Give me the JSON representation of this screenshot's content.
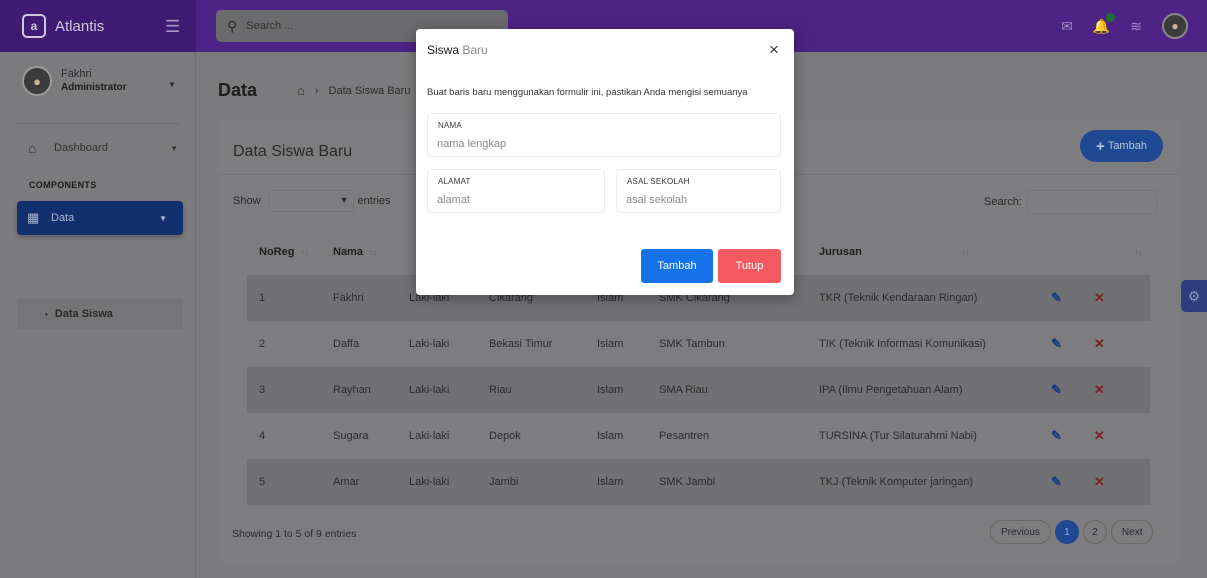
{
  "topbar": {
    "brand": "Atlantis",
    "logo_letter": "a",
    "search_placeholder": "Search ..."
  },
  "sidebar": {
    "user_name": "Fakhri",
    "user_role": "Administrator",
    "dashboard_label": "Dashboard",
    "section_title": "COMPONENTS",
    "data_label": "Data",
    "sub_item_label": "Data Siswa"
  },
  "page": {
    "title": "Data",
    "breadcrumb": "Data Siswa Baru"
  },
  "card": {
    "title": "Data Siswa Baru",
    "add_button": "Tambah",
    "show_label": "Show",
    "entries_label": "entries",
    "search_label": "Search:",
    "columns": [
      "NoReg",
      "Nama",
      "",
      "",
      "",
      "",
      "Jurusan",
      ""
    ],
    "rows": [
      [
        "1",
        "Fakhri",
        "Laki-laki",
        "Cikarang",
        "Islam",
        "SMK Cikarang",
        "TKR (Teknik Kendaraan Ringan)"
      ],
      [
        "2",
        "Daffa",
        "Laki-laki",
        "Bekasi Timur",
        "Islam",
        "SMK Tambun",
        "TIK (Teknik Informasi Komunikasi)"
      ],
      [
        "3",
        "Rayhan",
        "Laki-laki",
        "Riau",
        "Islam",
        "SMA Riau",
        "IPA (Ilmu Pengetahuan Alam)"
      ],
      [
        "4",
        "Sugara",
        "Laki-laki",
        "Depok",
        "Islam",
        "Pesantren",
        "TURSINA (Tur Silaturahmi Nabi)"
      ],
      [
        "5",
        "Amar",
        "Laki-laki",
        "Jambi",
        "Islam",
        "SMK Jambi",
        "TKJ (Teknik Komputer jaringan)"
      ]
    ],
    "footer_info": "Showing 1 to 5 of 9 entries",
    "pager": {
      "previous": "Previous",
      "pages": [
        "1",
        "2"
      ],
      "next": "Next"
    }
  },
  "modal": {
    "title_main": "Siswa",
    "title_light": "Baru",
    "description": "Buat baris baru menggunakan formulir ini, pastikan Anda mengisi semuanya",
    "nama_label": "NAMA",
    "nama_placeholder": "nama lengkap",
    "alamat_label": "ALAMAT",
    "alamat_placeholder": "alamat",
    "asal_label": "ASAL SEKOLAH",
    "asal_placeholder": "asal sekolah",
    "submit_button": "Tambah",
    "close_button": "Tutup"
  },
  "colors": {
    "topbar": "#4d2385",
    "primary": "#1572e8",
    "danger": "#f25961"
  }
}
